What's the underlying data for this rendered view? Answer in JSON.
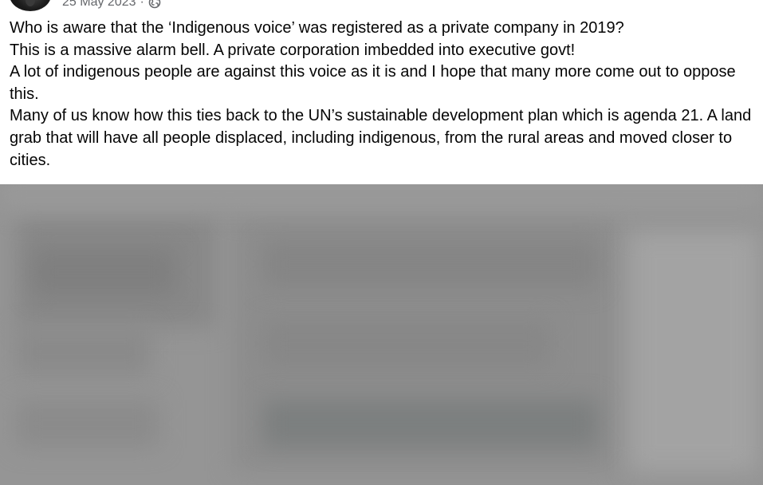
{
  "post": {
    "author_avatar_icon": "avatar",
    "timestamp": "25 May 2023",
    "separator": "·",
    "audience_icon": "globe-icon",
    "paragraphs": [
      "Who is aware that the ‘Indigenous voice’ was registered as a private company in 2019?",
      "This is a massive alarm bell. A private corporation imbedded into executive govt!",
      "A lot of indigenous people are against this voice as it is and I hope that many more come out to oppose this.",
      "Many of us know how this ties back to the UN’s sustainable development plan which is agenda 21.  A land grab that will have all people displaced, including indigenous, from the rural areas and moved closer to cities."
    ]
  },
  "colors": {
    "text": "#050505",
    "meta_text": "#65676b",
    "background": "#ffffff",
    "media_blur": "#959595"
  }
}
